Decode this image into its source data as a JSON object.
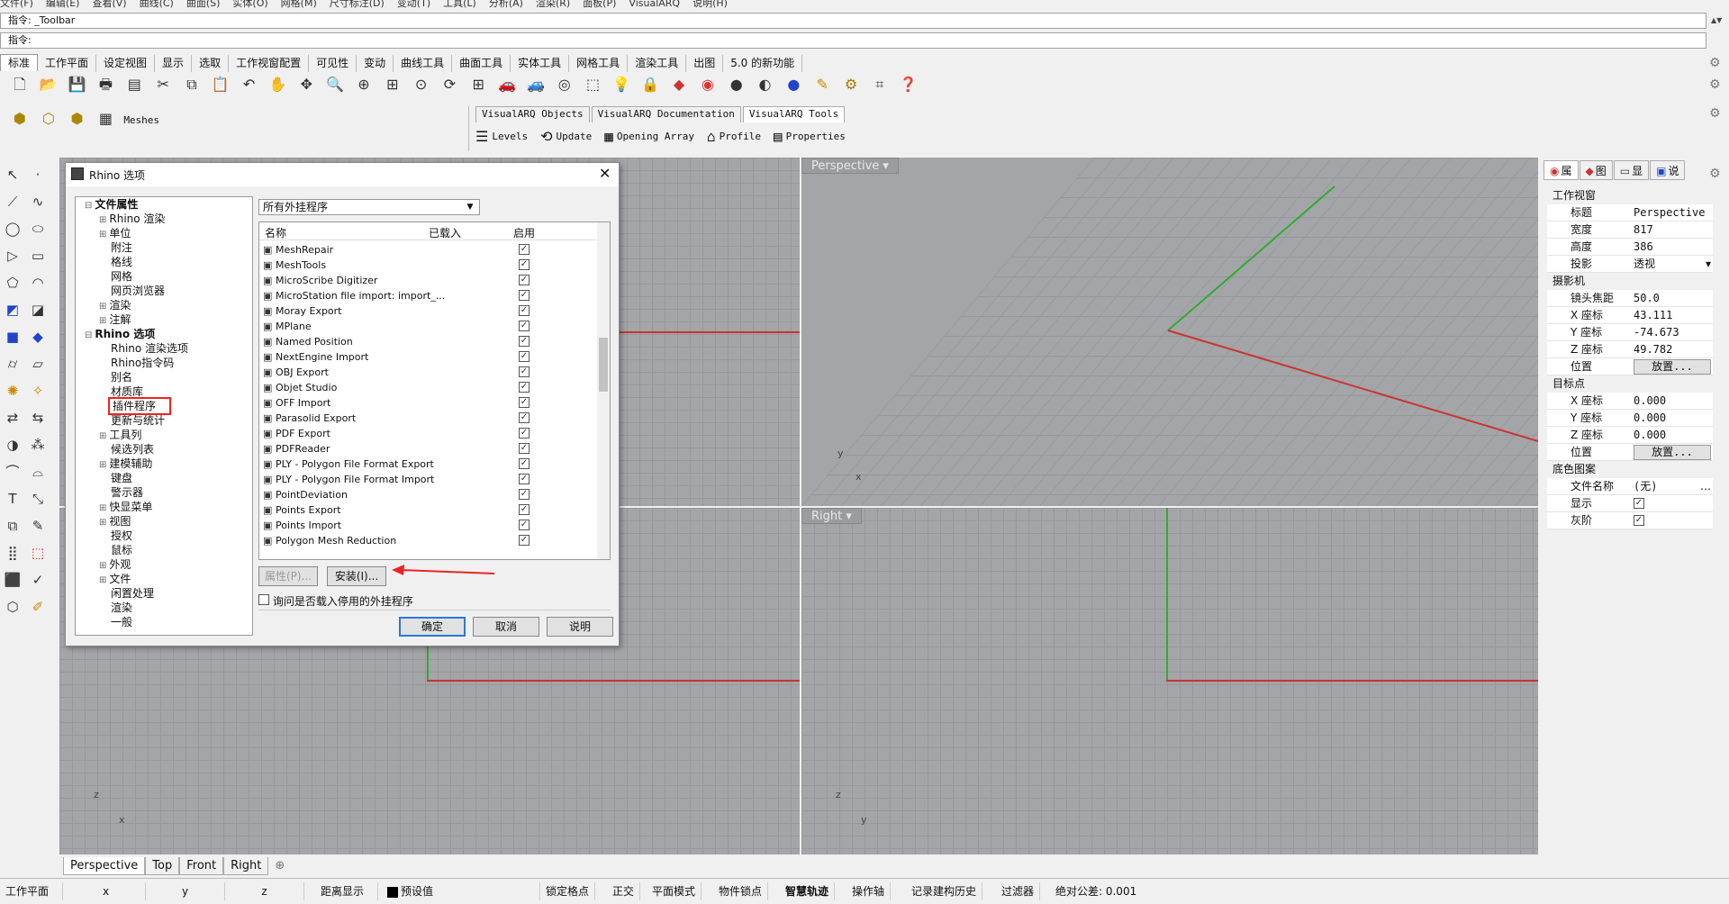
{
  "menu": [
    "文件(F)",
    "编辑(E)",
    "查看(V)",
    "曲线(C)",
    "曲面(S)",
    "实体(O)",
    "网格(M)",
    "尺寸标注(D)",
    "变动(T)",
    "工具(L)",
    "分析(A)",
    "渲染(R)",
    "面板(P)",
    "VisualARQ",
    "说明(H)"
  ],
  "command": {
    "history": "指令: _Toolbar",
    "prompt": "指令:"
  },
  "tabs": [
    "标准",
    "工作平面",
    "设定视图",
    "显示",
    "选取",
    "工作视窗配置",
    "可见性",
    "变动",
    "曲线工具",
    "曲面工具",
    "实体工具",
    "网格工具",
    "渲染工具",
    "出图",
    "5.0 的新功能"
  ],
  "meshes_label": "Meshes",
  "varq": {
    "tabs": [
      "VisualARQ Objects",
      "VisualARQ Documentation",
      "VisualARQ Tools"
    ],
    "tools": [
      "Levels",
      "Update",
      "Opening Array",
      "Profile",
      "Properties"
    ]
  },
  "dialog": {
    "title": "Rhino 选项",
    "tree": [
      {
        "t": "文件属性",
        "lvl": 0,
        "exp": "-",
        "bold": true
      },
      {
        "t": "Rhino 渲染",
        "lvl": 1,
        "exp": "+"
      },
      {
        "t": "单位",
        "lvl": 1,
        "exp": "+"
      },
      {
        "t": "附注",
        "lvl": 1
      },
      {
        "t": "格线",
        "lvl": 1
      },
      {
        "t": "网格",
        "lvl": 1
      },
      {
        "t": "网页浏览器",
        "lvl": 1
      },
      {
        "t": "渲染",
        "lvl": 1,
        "exp": "+"
      },
      {
        "t": "注解",
        "lvl": 1,
        "exp": "+"
      },
      {
        "t": "Rhino 选项",
        "lvl": 0,
        "exp": "-",
        "bold": true
      },
      {
        "t": "Rhino 渲染选项",
        "lvl": 1
      },
      {
        "t": "Rhino指令码",
        "lvl": 1
      },
      {
        "t": "别名",
        "lvl": 1
      },
      {
        "t": "材质库",
        "lvl": 1
      },
      {
        "t": "插件程序",
        "lvl": 1,
        "hl": true
      },
      {
        "t": "更新与统计",
        "lvl": 1
      },
      {
        "t": "工具列",
        "lvl": 1,
        "exp": "+"
      },
      {
        "t": "候选列表",
        "lvl": 1
      },
      {
        "t": "建模辅助",
        "lvl": 1,
        "exp": "+"
      },
      {
        "t": "键盘",
        "lvl": 1
      },
      {
        "t": "警示器",
        "lvl": 1
      },
      {
        "t": "快显菜单",
        "lvl": 1,
        "exp": "+"
      },
      {
        "t": "视图",
        "lvl": 1,
        "exp": "+"
      },
      {
        "t": "授权",
        "lvl": 1
      },
      {
        "t": "鼠标",
        "lvl": 1
      },
      {
        "t": "外观",
        "lvl": 1,
        "exp": "+"
      },
      {
        "t": "文件",
        "lvl": 1,
        "exp": "+"
      },
      {
        "t": "闲置处理",
        "lvl": 1
      },
      {
        "t": "渲染",
        "lvl": 1
      },
      {
        "t": "一般",
        "lvl": 1
      }
    ],
    "filter": "所有外挂程序",
    "columns": [
      "名称",
      "已载入",
      "启用"
    ],
    "plugins": [
      "MeshRepair",
      "MeshTools",
      "MicroScribe Digitizer",
      "MicroStation file import: import_...",
      "Moray Export",
      "MPlane",
      "Named Position",
      "NextEngine Import",
      "OBJ Export",
      "Objet Studio",
      "OFF Import",
      "Parasolid Export",
      "PDF Export",
      "PDFReader",
      "PLY - Polygon File Format Export",
      "PLY - Polygon File Format Import",
      "PointDeviation",
      "Points Export",
      "Points Import",
      "Polygon Mesh Reduction"
    ],
    "btn_props": "属性(P)...",
    "btn_install": "安装(I)...",
    "ask_label": "询问是否载入停用的外挂程序",
    "ok": "确定",
    "cancel": "取消",
    "help": "说明"
  },
  "viewports": {
    "perspective": "Perspective",
    "right": "Right"
  },
  "viewtabs": [
    "Perspective",
    "Top",
    "Front",
    "Right"
  ],
  "axes": {
    "y": "y",
    "x": "x",
    "z": "z"
  },
  "panel": {
    "tabs": [
      "属",
      "图",
      "显",
      "说"
    ],
    "sec1": "工作视窗",
    "r": [
      {
        "k": "标题",
        "v": "Perspective"
      },
      {
        "k": "宽度",
        "v": "817"
      },
      {
        "k": "高度",
        "v": "386"
      },
      {
        "k": "投影",
        "v": "透视"
      }
    ],
    "sec2": "摄影机",
    "cam": [
      {
        "k": "镜头焦距",
        "v": "50.0"
      },
      {
        "k": "X 座标",
        "v": "43.111"
      },
      {
        "k": "Y 座标",
        "v": "-74.673"
      },
      {
        "k": "Z 座标",
        "v": "49.782"
      },
      {
        "k": "位置",
        "v": "放置..."
      }
    ],
    "sec3": "目标点",
    "tgt": [
      {
        "k": "X 座标",
        "v": "0.000"
      },
      {
        "k": "Y 座标",
        "v": "0.000"
      },
      {
        "k": "Z 座标",
        "v": "0.000"
      },
      {
        "k": "位置",
        "v": "放置..."
      }
    ],
    "sec4": "底色图案",
    "bg": [
      {
        "k": "文件名称",
        "v": "(无)"
      },
      {
        "k": "显示",
        "v": ""
      },
      {
        "k": "灰阶",
        "v": ""
      }
    ]
  },
  "status": {
    "plane": "工作平面",
    "x": "x",
    "y": "y",
    "z": "z",
    "dist": "距离显示",
    "preset": "预设值",
    "items": [
      "锁定格点",
      "正交",
      "平面模式",
      "物件锁点",
      "智慧轨迹",
      "操作轴",
      "记录建构历史",
      "过滤器"
    ],
    "tol": "绝对公差: 0.001"
  }
}
